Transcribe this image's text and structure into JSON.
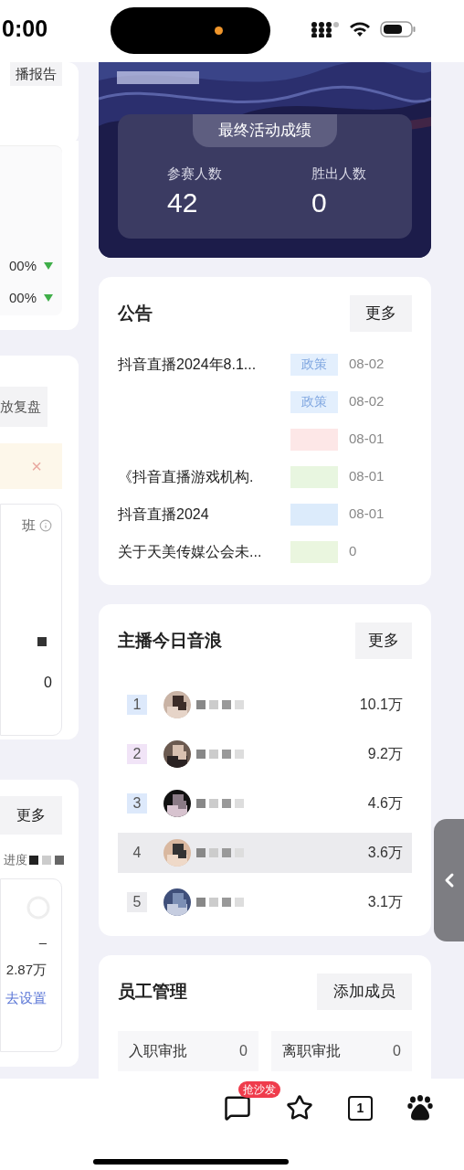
{
  "status_bar": {
    "time": "0:00"
  },
  "left_panel": {
    "report_button": "播报告",
    "ratios": [
      {
        "value": "00%",
        "falling": true
      },
      {
        "value": "00%",
        "falling": true
      }
    ],
    "review_tag": "放复盘",
    "notice_close": "×",
    "shift_label": "班",
    "shift_count": "0",
    "more_button": "更多",
    "progress_label": "进度",
    "amount_dash": "–",
    "amount": "2.87万",
    "setup_link": "去设置"
  },
  "result_card": {
    "title": "最终活动成绩",
    "stats": [
      {
        "label": "参赛人数",
        "value": "42"
      },
      {
        "label": "胜出人数",
        "value": "0"
      }
    ]
  },
  "announcements": {
    "title": "公告",
    "more": "更多",
    "items": [
      {
        "title": "抖音直播2024年8.1...",
        "tag": "政策",
        "color": "#e3effd",
        "date": "08-02"
      },
      {
        "tag": "政策",
        "color": "#e3effd",
        "date": "08-02"
      },
      {
        "color": "#fde7e7",
        "date": "08-01"
      },
      {
        "title": "《抖音直播游戏机构.",
        "color": "#e8f6e0",
        "date": "08-01"
      },
      {
        "title": "抖音直播2024",
        "color": "#dcebfb",
        "date": "08-01"
      },
      {
        "title": "关于天美传媒公会未...",
        "color": "#eaf6df",
        "date": "0"
      }
    ]
  },
  "anchors": {
    "title": "主播今日音浪",
    "more": "更多",
    "rows": [
      {
        "rank": "1",
        "color": "#dde9fb",
        "amount": "10.1万",
        "selected": false
      },
      {
        "rank": "2",
        "color": "#f1e4f7",
        "amount": "9.2万",
        "selected": false
      },
      {
        "rank": "3",
        "color": "#dde9fb",
        "amount": "4.6万",
        "selected": false
      },
      {
        "rank": "4",
        "color": "#ebebee",
        "amount": "3.6万",
        "selected": true
      },
      {
        "rank": "5",
        "color": "#ececef",
        "amount": "3.1万",
        "selected": false
      }
    ]
  },
  "staff": {
    "title": "员工管理",
    "add_button": "添加成员",
    "tiles": [
      {
        "label": "入职审批",
        "count": "0"
      },
      {
        "label": "离职审批",
        "count": "0"
      }
    ]
  },
  "bottom_bar": {
    "comment_badge": "抢沙发",
    "tab_count": "1"
  }
}
